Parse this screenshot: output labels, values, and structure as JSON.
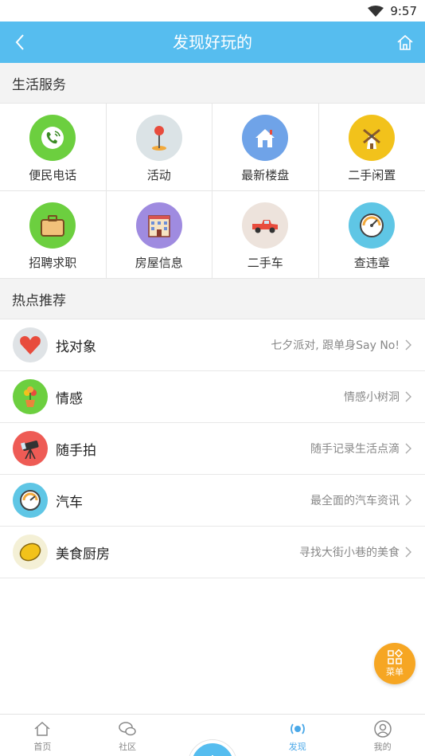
{
  "status": {
    "time": "9:57"
  },
  "header": {
    "title": "发现好玩的"
  },
  "life": {
    "title": "生活服务",
    "items": [
      {
        "label": "便民电话",
        "icon": "phone-icon",
        "color": "#6ccf3f"
      },
      {
        "label": "活动",
        "icon": "map-pin-icon",
        "color": "#dbe3e6"
      },
      {
        "label": "最新楼盘",
        "icon": "house-icon",
        "color": "#6fa3e8"
      },
      {
        "label": "二手闲置",
        "icon": "windmill-icon",
        "color": "#f2c21b"
      },
      {
        "label": "招聘求职",
        "icon": "briefcase-icon",
        "color": "#6ccf3f"
      },
      {
        "label": "房屋信息",
        "icon": "building-icon",
        "color": "#9f8be0"
      },
      {
        "label": "二手车",
        "icon": "pickup-truck-icon",
        "color": "#ede3dc"
      },
      {
        "label": "查违章",
        "icon": "speedometer-icon",
        "color": "#5fc6e5"
      }
    ]
  },
  "hot": {
    "title": "热点推荐",
    "items": [
      {
        "name": "找对象",
        "desc": "七夕派对, 跟单身Say No!",
        "icon": "heart-icon",
        "color": "#dfe3e6"
      },
      {
        "name": "情感",
        "desc": "情感小树洞",
        "icon": "flower-pot-icon",
        "color": "#6ccf3f"
      },
      {
        "name": "随手拍",
        "desc": "随手记录生活点滴",
        "icon": "telescope-icon",
        "color": "#ee5b55"
      },
      {
        "name": "汽车",
        "desc": "最全面的汽车资讯",
        "icon": "gauge-icon",
        "color": "#5fc6e5"
      },
      {
        "name": "美食厨房",
        "desc": "寻找大街小巷的美食",
        "icon": "lemon-icon",
        "color": "#f4f0d6"
      }
    ]
  },
  "fab": {
    "label": "菜单"
  },
  "tabs": [
    {
      "label": "首页",
      "icon": "home-icon"
    },
    {
      "label": "社区",
      "icon": "chat-icon"
    },
    {
      "label": "",
      "icon": "plus-icon"
    },
    {
      "label": "发现",
      "icon": "broadcast-icon",
      "active": true
    },
    {
      "label": "我的",
      "icon": "user-icon"
    }
  ]
}
